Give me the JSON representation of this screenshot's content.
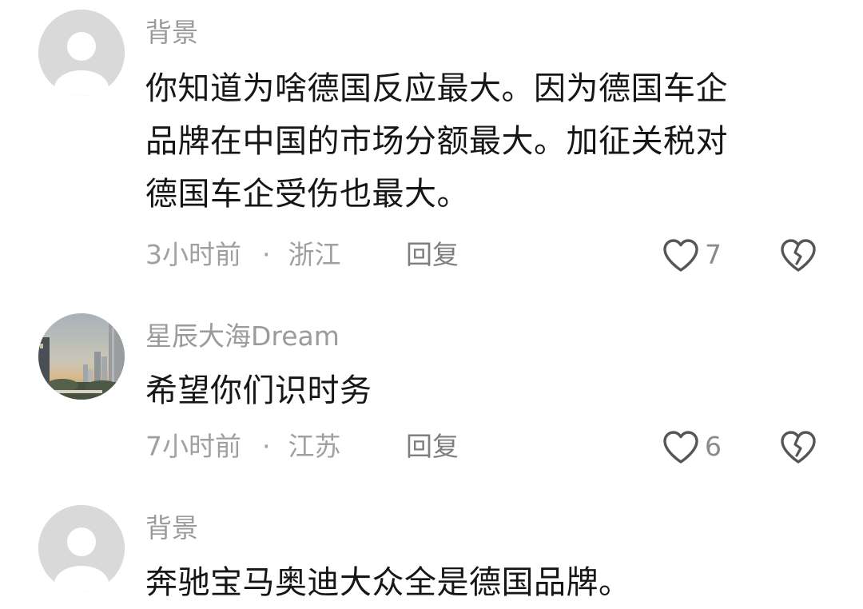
{
  "comments": [
    {
      "username": "背景",
      "avatar_icon": "default-avatar-icon",
      "lines": [
        "你知道为啥德国反应最大。因为德国车企",
        "品牌在中国的市场分额最大。加征关税对",
        "德国车企受伤也最大。"
      ],
      "time": "3小时前",
      "separator": "·",
      "location": "浙江",
      "reply_label": "回复",
      "like_icon": "heart-outline-icon",
      "like_count": "7",
      "dislike_icon": "broken-heart-icon"
    },
    {
      "username": "星辰大海Dream",
      "avatar_icon": "city-skyline-photo-avatar",
      "lines": [
        "希望你们识时务"
      ],
      "time": "7小时前",
      "separator": "·",
      "location": "江苏",
      "reply_label": "回复",
      "like_icon": "heart-outline-icon",
      "like_count": "6",
      "dislike_icon": "broken-heart-icon"
    },
    {
      "username": "背景",
      "avatar_icon": "default-avatar-icon",
      "lines": [
        "奔驰宝马奥迪大众全是德国品牌。"
      ]
    }
  ],
  "colors": {
    "username": "#9b9b9b",
    "text": "#161616",
    "meta": "#a0a0a0",
    "icon_stroke": "#555555",
    "default_avatar_bg": "#d9d9d9"
  }
}
